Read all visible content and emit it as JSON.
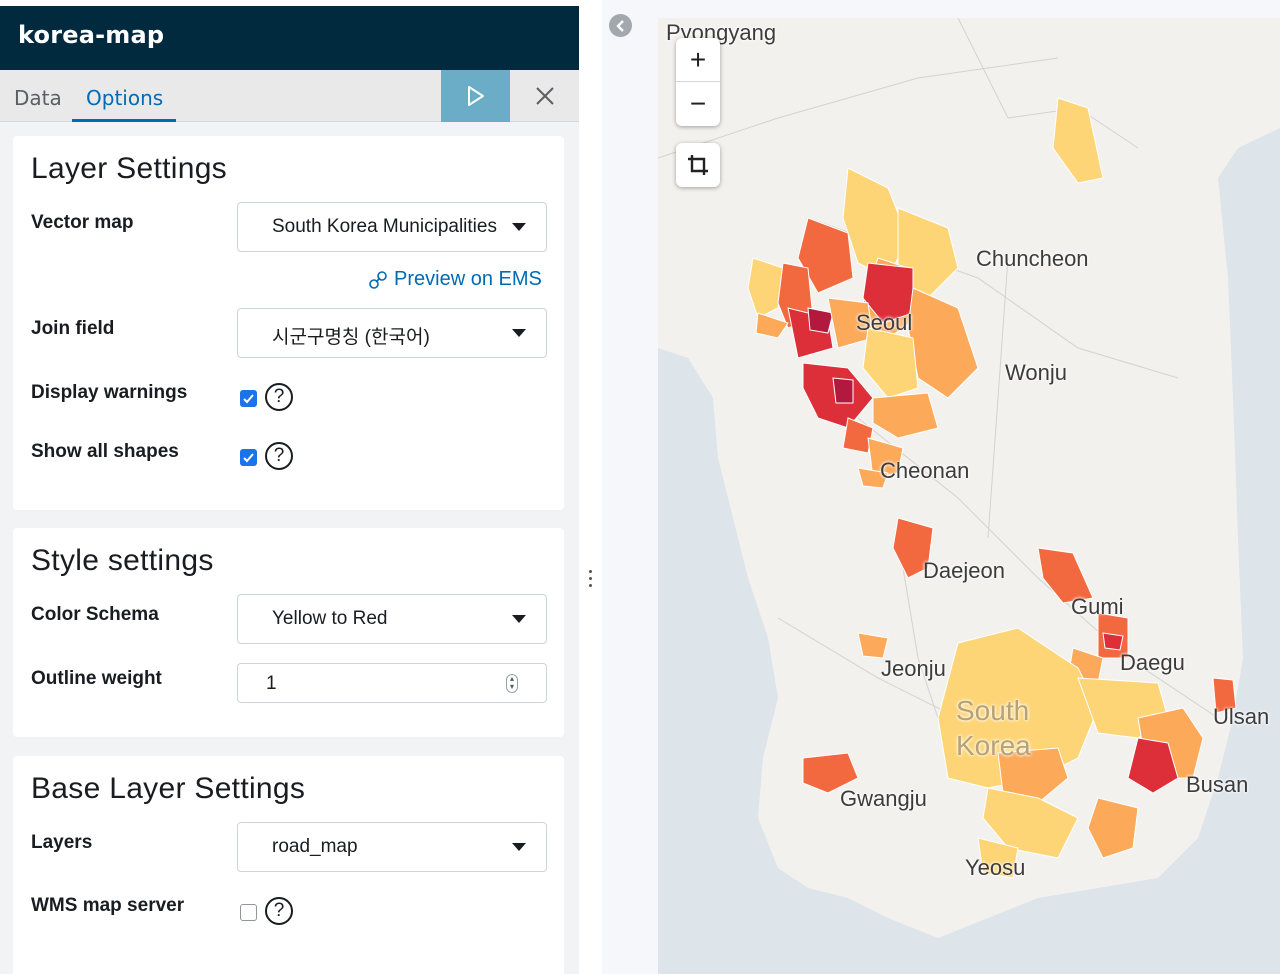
{
  "app": {
    "title": "korea-map"
  },
  "tabs": {
    "data": "Data",
    "options": "Options"
  },
  "layer_settings": {
    "title": "Layer Settings",
    "vector_map_label": "Vector map",
    "vector_map_value": "South Korea Municipalities",
    "preview_link": "Preview on EMS",
    "join_field_label": "Join field",
    "join_field_value": "시군구명칭 (한국어)",
    "display_warnings_label": "Display warnings",
    "display_warnings_checked": true,
    "show_all_shapes_label": "Show all shapes",
    "show_all_shapes_checked": true
  },
  "style_settings": {
    "title": "Style settings",
    "color_schema_label": "Color Schema",
    "color_schema_value": "Yellow to Red",
    "outline_weight_label": "Outline weight",
    "outline_weight_value": "1"
  },
  "base_layer_settings": {
    "title": "Base Layer Settings",
    "layers_label": "Layers",
    "layers_value": "road_map",
    "wms_label": "WMS map server",
    "wms_checked": false
  },
  "help_glyph": "?",
  "map": {
    "zoom_in": "+",
    "zoom_out": "−",
    "cities": {
      "pyongyang": "Pyongyang",
      "chuncheon": "Chuncheon",
      "seoul": "Seoul",
      "wonju": "Wonju",
      "cheonan": "Cheonan",
      "daejeon": "Daejeon",
      "gumi": "Gumi",
      "daegu": "Daegu",
      "jeonju": "Jeonju",
      "ulsan": "Ulsan",
      "south_korea_1": "South",
      "south_korea_2": "Korea",
      "gwangju": "Gwangju",
      "busan": "Busan",
      "yeosu": "Yeosu"
    },
    "colors": {
      "water": "#dde4ea",
      "land": "#f2f1ee",
      "light_yellow": "#fdd576",
      "orange": "#fca95a",
      "red_orange": "#f2683f",
      "red": "#dd2f3a",
      "dark_red": "#b3193f"
    }
  },
  "colors": {
    "header_bg": "#022a3e",
    "accent": "#006bb4",
    "apply_button": "#6bacc6"
  }
}
